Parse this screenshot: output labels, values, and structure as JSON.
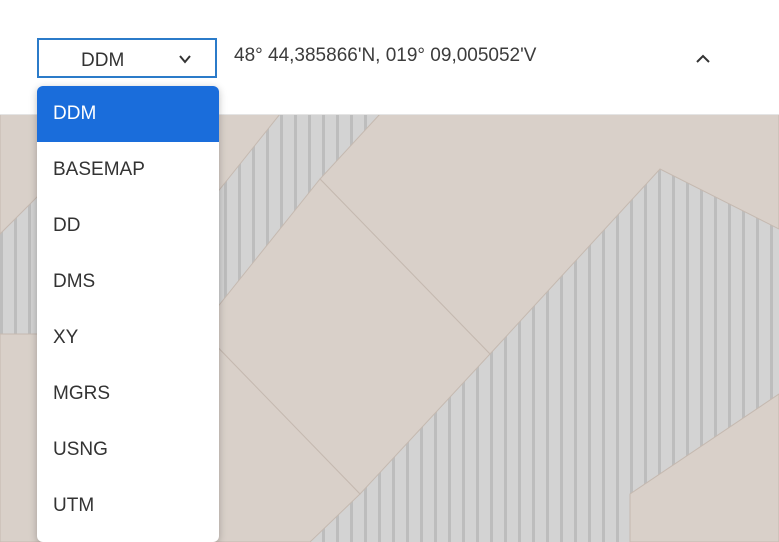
{
  "coordinate_widget": {
    "format_select": {
      "selected": "DDM"
    },
    "coordinate_text": "48° 44,385866'N, 019° 09,005052'V",
    "collapse_icon": "chevron-up-icon"
  },
  "dropdown": {
    "items": [
      {
        "label": "DDM",
        "selected": true
      },
      {
        "label": "BASEMAP",
        "selected": false
      },
      {
        "label": "DD",
        "selected": false
      },
      {
        "label": "DMS",
        "selected": false
      },
      {
        "label": "XY",
        "selected": false
      },
      {
        "label": "MGRS",
        "selected": false
      },
      {
        "label": "USNG",
        "selected": false
      },
      {
        "label": "UTM",
        "selected": false
      }
    ]
  },
  "colors": {
    "accent": "#1a6ddb",
    "select_border": "#2b7bc9",
    "map_beige": "#d9d0c9",
    "map_gray": "#d1d1d1"
  }
}
